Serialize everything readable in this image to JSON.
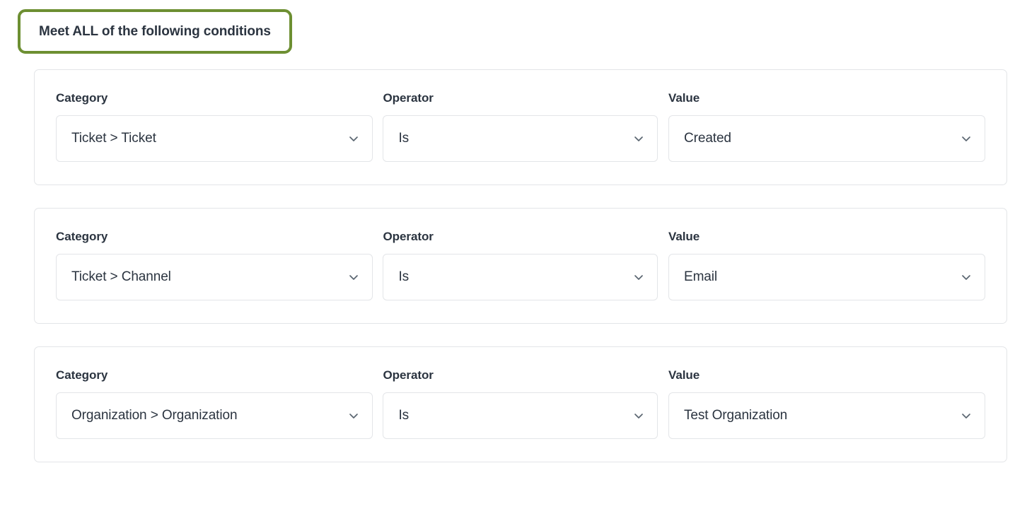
{
  "header": {
    "pill_label": "Meet ALL of the following conditions",
    "highlight_color": "#6d8f32"
  },
  "labels": {
    "category": "Category",
    "operator": "Operator",
    "value": "Value"
  },
  "icons": {
    "chevron": "chevron-down-icon"
  },
  "colors": {
    "text": "#2b3440",
    "border": "#e3e5e8",
    "chevron": "#5a6570",
    "card_background": "#ffffff"
  },
  "conditions": [
    {
      "category_label": "Category",
      "operator_label": "Operator",
      "value_label": "Value",
      "category": "Ticket > Ticket",
      "operator": "Is",
      "value": "Created"
    },
    {
      "category_label": "Category",
      "operator_label": "Operator",
      "value_label": "Value",
      "category": "Ticket > Channel",
      "operator": "Is",
      "value": "Email"
    },
    {
      "category_label": "Category",
      "operator_label": "Operator",
      "value_label": "Value",
      "category": "Organization > Organization",
      "operator": "Is",
      "value": "Test Organization"
    }
  ]
}
